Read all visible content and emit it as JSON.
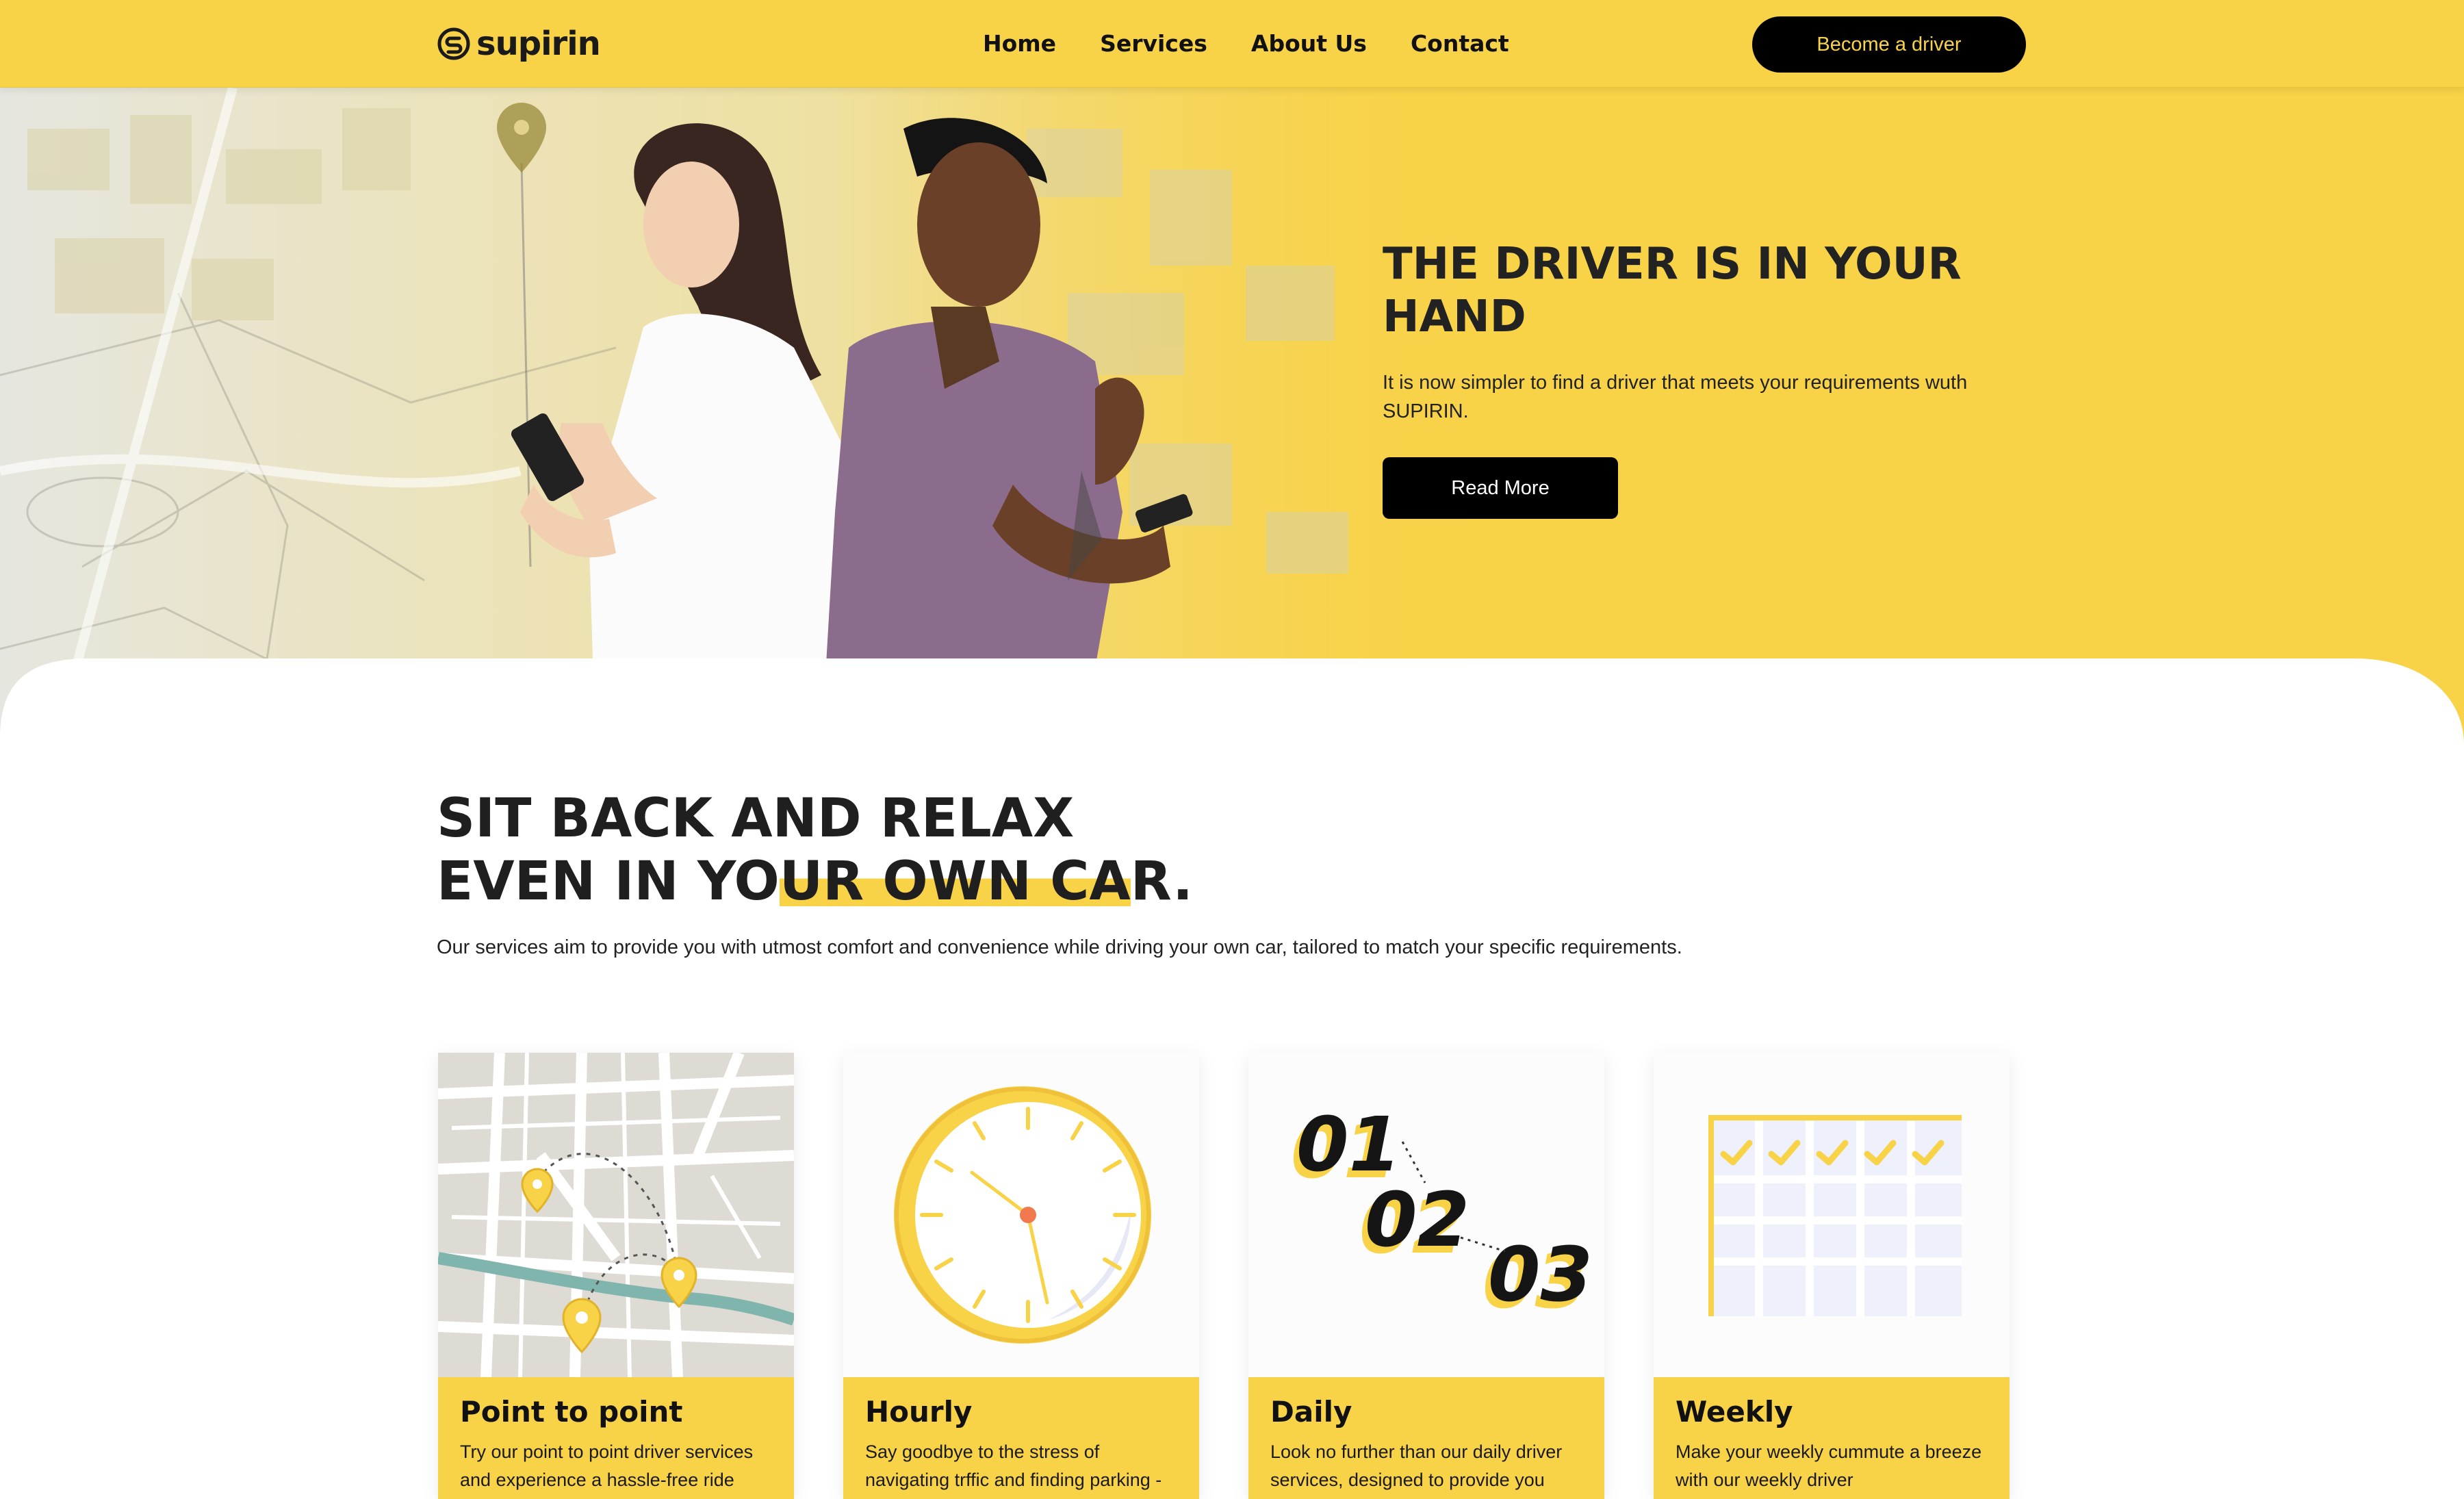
{
  "brand": {
    "name": "supirin",
    "primary_color": "#f8d247",
    "dark_color": "#000000"
  },
  "nav": {
    "links": [
      "Home",
      "Services",
      "About Us",
      "Contact"
    ],
    "cta_label": "Become a driver"
  },
  "hero": {
    "title": "THE DRIVER IS IN YOUR HAND",
    "text": "It is now simpler to find a driver that meets your requirements wuth SUPIRIN.",
    "button_label": "Read More"
  },
  "section": {
    "title_line1": "SIT BACK AND RELAX",
    "title_line2_a": "EVEN IN YO",
    "title_line2_hl": "UR OWN CA",
    "title_line2_b": "R.",
    "text": "Our services aim to provide you with utmost comfort and convenience while driving your own car, tailored to match your specific requirements."
  },
  "cards": [
    {
      "title": "Point to point",
      "text": "Try our point to point driver services and experience a hassle-free ride",
      "icon": "map-pins-icon"
    },
    {
      "title": "Hourly",
      "text": "Say goodbye to the stress of navigating trffic and finding parking -",
      "icon": "clock-icon"
    },
    {
      "title": "Daily",
      "text": "Look no further than our daily driver services, designed to provide you",
      "icon": "numbers-icon",
      "numbers": [
        "01",
        "02",
        "03"
      ]
    },
    {
      "title": "Weekly",
      "text": "Make your weekly cummute a breeze with our weekly driver",
      "icon": "calendar-icon"
    }
  ]
}
